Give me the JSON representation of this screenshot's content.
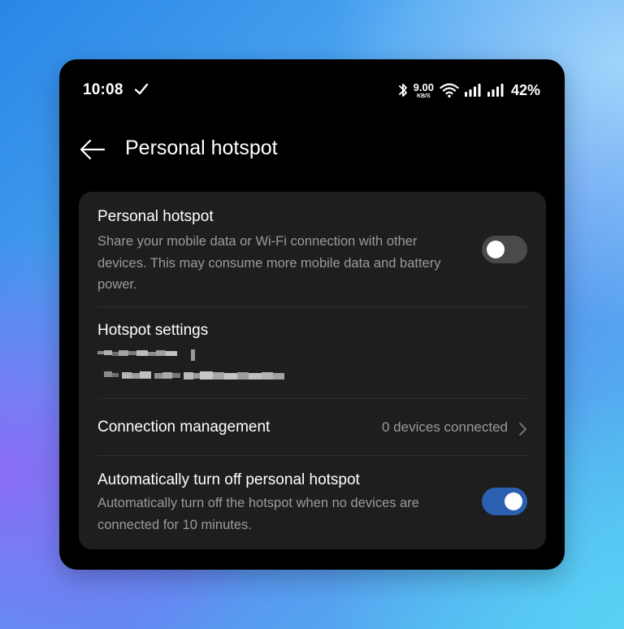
{
  "status_bar": {
    "time": "10:08",
    "speed_value": "9.00",
    "speed_unit": "KB/S",
    "battery": "42%"
  },
  "header": {
    "title": "Personal hotspot"
  },
  "hotspot": {
    "title": "Personal hotspot",
    "description": "Share your mobile data or Wi-Fi connection with other devices. This may consume more mobile data and battery power.",
    "enabled": false
  },
  "hotspot_settings": {
    "title": "Hotspot settings"
  },
  "connection_management": {
    "title": "Connection management",
    "value": "0 devices connected"
  },
  "auto_off": {
    "title": "Automatically turn off personal hotspot",
    "description": "Automatically turn off the hotspot when no devices are connected for 10 minutes.",
    "enabled": true
  },
  "colors": {
    "toggle_on": "#2b5fb0",
    "toggle_off": "#4a4a4a",
    "card_bg": "#1e1e1e"
  }
}
